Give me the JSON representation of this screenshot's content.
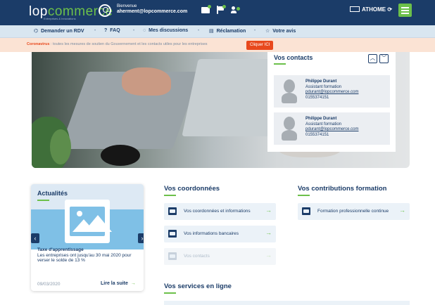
{
  "header": {
    "logo_main": "lop",
    "logo_accent": "commerce",
    "logo_tagline": "Entreprises & Innovations",
    "welcome_label": "Bienvenue",
    "user_email": "aherment@lopcommerce.com",
    "workspace_label": "ATHOME",
    "accent_color": "#6cc04a",
    "bar_color": "#1b3c68"
  },
  "nav": {
    "items": [
      {
        "icon": "chat-icon",
        "label": "Demander un RDV"
      },
      {
        "icon": "question-icon",
        "label": "FAQ"
      },
      {
        "icon": "discussion-icon",
        "label": "Mes discussions"
      },
      {
        "icon": "document-icon",
        "label": "Réclamation"
      },
      {
        "icon": "star-icon",
        "label": "Votre avis"
      }
    ]
  },
  "alert": {
    "strong": "Coronavirus",
    "text": " : toutes les mesures de soutien du Gouvernement et les contacts utiles pour les entreprises",
    "button": "Cliquer ICI",
    "button_color": "#e8491d"
  },
  "contacts": {
    "title": "Vos contacts",
    "cards": [
      {
        "name": "Philippe Durant",
        "role": "Assistant formation",
        "email": "pdurant@lopcommerce.com",
        "phone": "0155374151"
      },
      {
        "name": "Philippe Durant",
        "role": "Assistant formation",
        "email": "pdurant@lopcommerce.com",
        "phone": "0155374151"
      }
    ]
  },
  "news": {
    "title": "Actualités",
    "item_title": "Taxe d'apprentissage",
    "item_text": "Les entreprises ont jusqu'au 30 mai 2020 pour verser le solde de 13 %",
    "date": "09/03/2020",
    "read_more": "Lire la suite"
  },
  "coordonnees": {
    "title": "Vos coordonnées",
    "rows": [
      {
        "label": "Vos coordonnées et informations",
        "icon": "id-card-icon"
      },
      {
        "label": "Vos informations bancaires",
        "icon": "bank-card-icon"
      },
      {
        "label": "Vos contacts",
        "icon": "contact-book-icon"
      }
    ]
  },
  "contributions": {
    "title": "Vos contributions formation",
    "rows": [
      {
        "label": "Formation professionnelle continue",
        "icon": "graduation-cap-icon"
      }
    ]
  },
  "services": {
    "title": "Vos services en ligne"
  }
}
